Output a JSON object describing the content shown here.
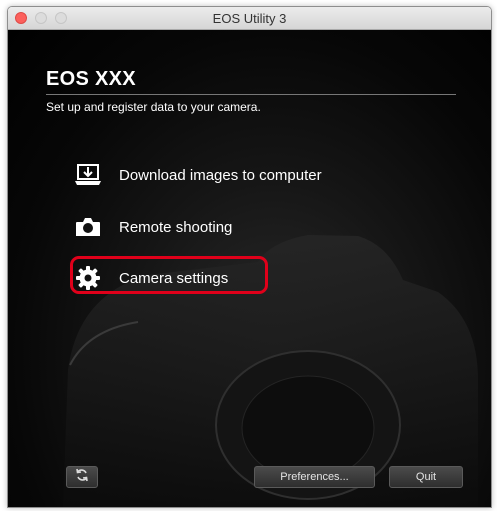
{
  "window": {
    "title": "EOS Utility 3"
  },
  "header": {
    "model": "EOS XXX",
    "subtitle": "Set up and register data to your camera."
  },
  "menu": [
    {
      "label": "Download images to computer",
      "icon": "download-to-computer-icon"
    },
    {
      "label": "Remote shooting",
      "icon": "camera-icon"
    },
    {
      "label": "Camera settings",
      "icon": "gear-icon",
      "highlighted": true
    }
  ],
  "footer": {
    "sync_icon": "sync-icon",
    "preferences_label": "Preferences...",
    "quit_label": "Quit"
  },
  "colors": {
    "highlight": "#e0001a",
    "background": "#000000",
    "text": "#ffffff"
  }
}
